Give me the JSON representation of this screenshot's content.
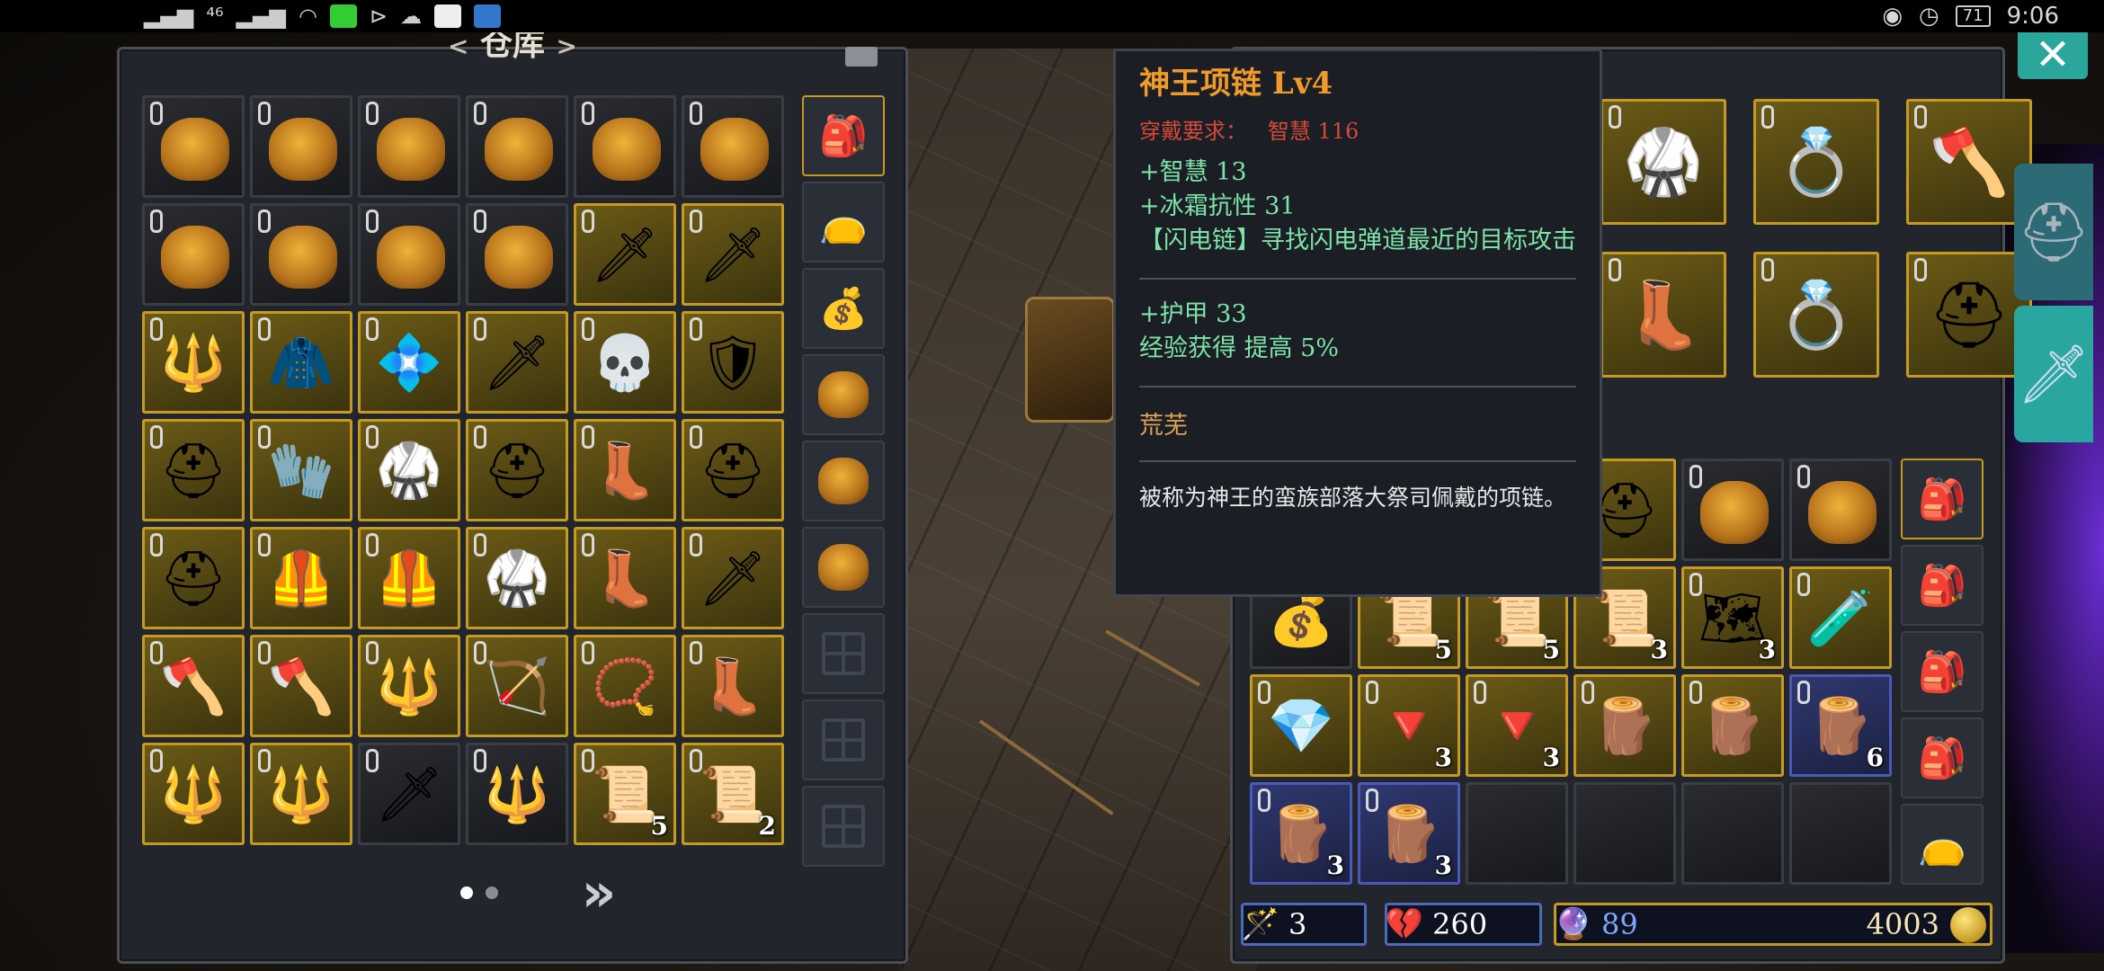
{
  "status_bar": {
    "network": "⁴⁶",
    "time": "9:06",
    "battery": "71"
  },
  "warehouse": {
    "title": "仓库",
    "arrow_left": "<",
    "arrow_right": ">",
    "next_label": "»",
    "slots": [
      {
        "type": "plain",
        "glyph": "bag",
        "qty": ""
      },
      {
        "type": "plain",
        "glyph": "bag",
        "qty": ""
      },
      {
        "type": "plain",
        "glyph": "bag",
        "qty": ""
      },
      {
        "type": "plain",
        "glyph": "bag",
        "qty": ""
      },
      {
        "type": "plain",
        "glyph": "bag",
        "qty": ""
      },
      {
        "type": "plain",
        "glyph": "bag",
        "qty": ""
      },
      {
        "type": "plain",
        "glyph": "bag",
        "qty": ""
      },
      {
        "type": "plain",
        "glyph": "bag",
        "qty": ""
      },
      {
        "type": "plain",
        "glyph": "bag",
        "qty": ""
      },
      {
        "type": "plain",
        "glyph": "bag",
        "qty": ""
      },
      {
        "type": "gold",
        "glyph": "🗡",
        "qty": ""
      },
      {
        "type": "gold",
        "glyph": "🗡",
        "qty": ""
      },
      {
        "type": "gold",
        "glyph": "🔱",
        "qty": ""
      },
      {
        "type": "gold",
        "glyph": "🧥",
        "qty": ""
      },
      {
        "type": "gold",
        "glyph": "💠",
        "qty": ""
      },
      {
        "type": "gold",
        "glyph": "🗡",
        "qty": ""
      },
      {
        "type": "gold",
        "glyph": "💀",
        "qty": ""
      },
      {
        "type": "gold",
        "glyph": "🛡",
        "qty": ""
      },
      {
        "type": "gold",
        "glyph": "⛑",
        "qty": ""
      },
      {
        "type": "gold",
        "glyph": "🧤",
        "qty": ""
      },
      {
        "type": "gold",
        "glyph": "🥋",
        "qty": ""
      },
      {
        "type": "gold",
        "glyph": "⛑",
        "qty": ""
      },
      {
        "type": "gold",
        "glyph": "👢",
        "qty": ""
      },
      {
        "type": "gold",
        "glyph": "⛑",
        "qty": ""
      },
      {
        "type": "gold",
        "glyph": "⛑",
        "qty": ""
      },
      {
        "type": "gold",
        "glyph": "🦺",
        "qty": ""
      },
      {
        "type": "gold",
        "glyph": "🦺",
        "qty": ""
      },
      {
        "type": "gold",
        "glyph": "🥋",
        "qty": ""
      },
      {
        "type": "gold",
        "glyph": "👢",
        "qty": ""
      },
      {
        "type": "gold",
        "glyph": "🗡",
        "qty": ""
      },
      {
        "type": "gold",
        "glyph": "🪓",
        "qty": ""
      },
      {
        "type": "gold",
        "glyph": "🪓",
        "qty": ""
      },
      {
        "type": "gold",
        "glyph": "🔱",
        "qty": ""
      },
      {
        "type": "gold",
        "glyph": "🏹",
        "qty": ""
      },
      {
        "type": "gold",
        "glyph": "📿",
        "qty": ""
      },
      {
        "type": "gold",
        "glyph": "👢",
        "qty": ""
      },
      {
        "type": "gold",
        "glyph": "🔱",
        "qty": ""
      },
      {
        "type": "gold",
        "glyph": "🔱",
        "qty": ""
      },
      {
        "type": "plain",
        "glyph": "🗡",
        "qty": ""
      },
      {
        "type": "plain",
        "glyph": "🔱",
        "qty": ""
      },
      {
        "type": "gold",
        "glyph": "📜",
        "qty": "5"
      },
      {
        "type": "gold",
        "glyph": "📜",
        "qty": "2"
      }
    ],
    "side_bags": [
      "🎒",
      "👝",
      "💰",
      "bag",
      "bag",
      "bag",
      "empty",
      "empty",
      "empty"
    ]
  },
  "tooltip": {
    "name": "神王项链 Lv4",
    "requirement_label": "穿戴要求：",
    "requirement_value": "智慧 116",
    "stat1": "+智慧 13",
    "stat2": "+冰霜抗性 31",
    "stat3": "【闪电链】寻找闪电弹道最近的目标攻击",
    "stat4": "+护甲 33",
    "stat5": "经验获得 提高 5%",
    "set_name": "荒芜",
    "description": "被称为神王的蛮族部落大祭司佩戴的项链。"
  },
  "equipment": [
    {
      "type": "gold",
      "glyph": "🥋"
    },
    {
      "type": "gold",
      "glyph": "💍"
    },
    {
      "type": "gold",
      "glyph": "🪓"
    },
    {
      "type": "gold",
      "glyph": "👢"
    },
    {
      "type": "gold",
      "glyph": "💍"
    },
    {
      "type": "gold",
      "glyph": "⛑"
    }
  ],
  "inventory": {
    "slots": [
      {
        "type": "plain",
        "glyph": "",
        "qty": ""
      },
      {
        "type": "plain",
        "glyph": "",
        "qty": ""
      },
      {
        "type": "plain",
        "glyph": "",
        "qty": ""
      },
      {
        "type": "gold",
        "glyph": "⛑",
        "qty": ""
      },
      {
        "type": "plain",
        "glyph": "bag",
        "qty": ""
      },
      {
        "type": "plain",
        "glyph": "bag",
        "qty": ""
      },
      {
        "type": "plain",
        "glyph": "💰",
        "qty": ""
      },
      {
        "type": "gold",
        "glyph": "📜",
        "qty": "5"
      },
      {
        "type": "gold",
        "glyph": "📜",
        "qty": "5"
      },
      {
        "type": "gold",
        "glyph": "📜",
        "qty": "3"
      },
      {
        "type": "gold",
        "glyph": "🗺",
        "qty": "3"
      },
      {
        "type": "gold",
        "glyph": "🧪",
        "qty": ""
      },
      {
        "type": "gold",
        "glyph": "💎",
        "qty": ""
      },
      {
        "type": "gold",
        "glyph": "🔻",
        "qty": "3"
      },
      {
        "type": "gold",
        "glyph": "🔻",
        "qty": "3"
      },
      {
        "type": "gold",
        "glyph": "🪵",
        "qty": ""
      },
      {
        "type": "gold",
        "glyph": "🪵",
        "qty": ""
      },
      {
        "type": "blue",
        "glyph": "🪵",
        "qty": "6"
      },
      {
        "type": "blue",
        "glyph": "🪵",
        "qty": "3"
      },
      {
        "type": "blue",
        "glyph": "🪵",
        "qty": "3"
      },
      {
        "type": "plain",
        "glyph": "",
        "qty": ""
      },
      {
        "type": "plain",
        "glyph": "",
        "qty": ""
      },
      {
        "type": "plain",
        "glyph": "",
        "qty": ""
      },
      {
        "type": "plain",
        "glyph": "",
        "qty": ""
      }
    ],
    "side_bags": [
      "🎒",
      "🎒",
      "🎒",
      "🎒",
      "👝"
    ]
  },
  "currencies": {
    "staff": "3",
    "heart": "260",
    "crystal": "89",
    "gold": "4003"
  },
  "close_label": "✕"
}
